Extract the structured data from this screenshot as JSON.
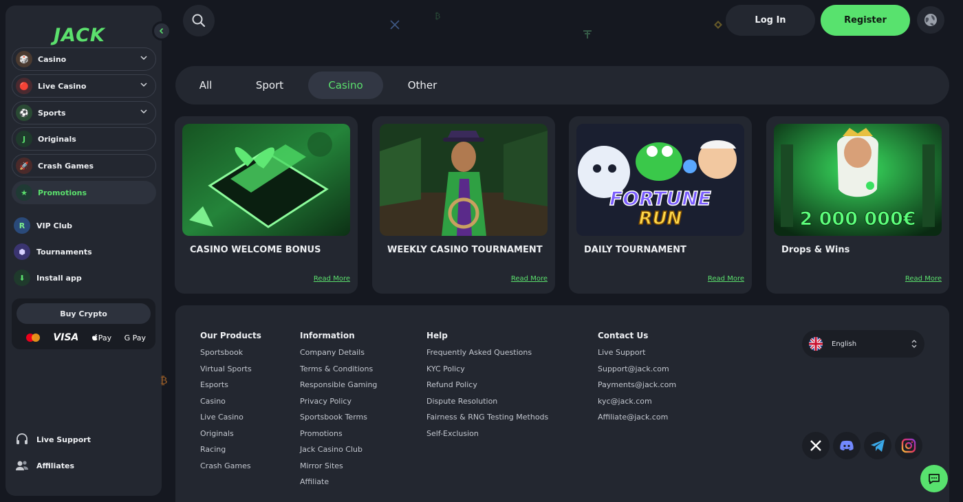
{
  "brand": {
    "logo_text": "JACK",
    "accent": "#58e26e"
  },
  "sidebar": {
    "nav": [
      {
        "label": "Casino",
        "icon": "casino-icon",
        "expandable": true
      },
      {
        "label": "Live Casino",
        "icon": "live-casino-icon",
        "expandable": true
      },
      {
        "label": "Sports",
        "icon": "sports-icon",
        "expandable": true
      },
      {
        "label": "Originals",
        "icon": "originals-icon",
        "expandable": false
      },
      {
        "label": "Crash Games",
        "icon": "crash-games-icon",
        "expandable": false
      },
      {
        "label": "Promotions",
        "icon": "promotions-icon",
        "expandable": false,
        "active": true
      }
    ],
    "extras": [
      {
        "label": "VIP Club",
        "icon": "vip-club-icon"
      },
      {
        "label": "Tournaments",
        "icon": "tournaments-icon"
      },
      {
        "label": "Install app",
        "icon": "install-app-icon"
      }
    ],
    "buy_crypto": {
      "label": "Buy Crypto",
      "methods": [
        "Mastercard",
        "VISA",
        "Pay",
        "G Pay"
      ]
    },
    "bottom": [
      {
        "label": "Live Support",
        "icon": "headset-icon"
      },
      {
        "label": "Affiliates",
        "icon": "users-icon"
      }
    ]
  },
  "header": {
    "login_label": "Log In",
    "register_label": "Register"
  },
  "tabs": [
    {
      "label": "All"
    },
    {
      "label": "Sport"
    },
    {
      "label": "Casino",
      "active": true
    },
    {
      "label": "Other"
    }
  ],
  "promos": [
    {
      "title": "CASINO WELCOME BONUS",
      "link": "Read More"
    },
    {
      "title": "WEEKLY CASINO TOURNAMENT",
      "link": "Read More"
    },
    {
      "title": "DAILY TOURNAMENT",
      "link": "Read More",
      "art_text": [
        "FORTUNE",
        "RUN"
      ]
    },
    {
      "title": "Drops & Wins",
      "link": "Read More",
      "art_text": [
        "2 000 000€"
      ]
    }
  ],
  "footer": {
    "columns": [
      {
        "heading": "Our Products",
        "links": [
          "Sportsbook",
          "Virtual Sports",
          "Esports",
          "Casino",
          "Live Casino",
          "Originals",
          "Racing",
          "Crash Games"
        ]
      },
      {
        "heading": "Information",
        "links": [
          "Company Details",
          "Terms & Conditions",
          "Responsible Gaming",
          "Privacy Policy",
          "Sportsbook Terms",
          "Promotions",
          "Jack Casino Club",
          "Mirror Sites",
          "Affiliate"
        ]
      },
      {
        "heading": "Help",
        "links": [
          "Frequently Asked Questions",
          "KYC Policy",
          "Refund Policy",
          "Dispute Resolution",
          "Fairness & RNG Testing Methods",
          "Self-Exclusion"
        ]
      },
      {
        "heading": "Contact Us",
        "links": [
          "Live Support",
          "Support@jack.com",
          "Payments@jack.com",
          "kyc@jack.com",
          "Affiliate@jack.com"
        ]
      }
    ],
    "language": "English",
    "social": [
      "x-icon",
      "discord-icon",
      "telegram-icon",
      "instagram-icon"
    ]
  }
}
